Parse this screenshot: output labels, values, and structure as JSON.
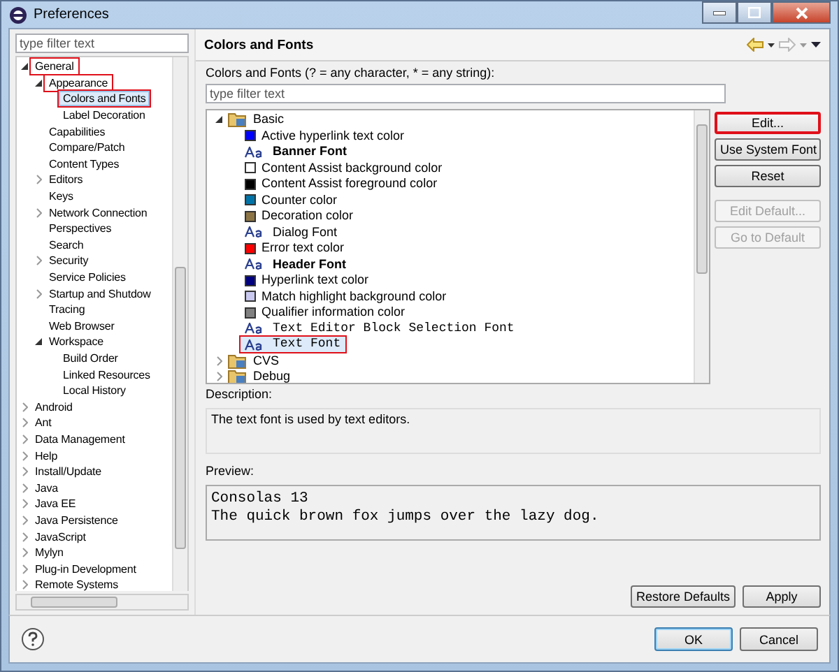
{
  "window": {
    "title": "Preferences"
  },
  "sidebar": {
    "filter": {
      "placeholder": "type filter text"
    },
    "tree": [
      {
        "label": "General",
        "expanded": true,
        "selected": false,
        "highlighted": true,
        "children": [
          {
            "label": "Appearance",
            "expanded": true,
            "selected": false,
            "highlighted": true,
            "children": [
              {
                "label": "Colors and Fonts",
                "selected": true,
                "highlighted": true
              },
              {
                "label": "Label Decoration",
                "selected": false,
                "highlighted": false
              }
            ]
          },
          {
            "label": "Capabilities",
            "selected": false,
            "highlighted": false
          },
          {
            "label": "Compare/Patch",
            "selected": false,
            "highlighted": false
          },
          {
            "label": "Content Types",
            "selected": false,
            "highlighted": false
          },
          {
            "label": "Editors",
            "expanded": false,
            "selected": false,
            "highlighted": false
          },
          {
            "label": "Keys",
            "selected": false,
            "highlighted": false
          },
          {
            "label": "Network Connection",
            "expanded": false,
            "selected": false,
            "highlighted": false
          },
          {
            "label": "Perspectives",
            "selected": false,
            "highlighted": false
          },
          {
            "label": "Search",
            "selected": false,
            "highlighted": false
          },
          {
            "label": "Security",
            "expanded": false,
            "selected": false,
            "highlighted": false
          },
          {
            "label": "Service Policies",
            "selected": false,
            "highlighted": false
          },
          {
            "label": "Startup and Shutdow",
            "expanded": false,
            "selected": false,
            "highlighted": false
          },
          {
            "label": "Tracing",
            "selected": false,
            "highlighted": false
          },
          {
            "label": "Web Browser",
            "selected": false,
            "highlighted": false
          },
          {
            "label": "Workspace",
            "expanded": true,
            "selected": false,
            "highlighted": false,
            "children": [
              {
                "label": "Build Order",
                "selected": false,
                "highlighted": false
              },
              {
                "label": "Linked Resources",
                "selected": false,
                "highlighted": false
              },
              {
                "label": "Local History",
                "selected": false,
                "highlighted": false
              }
            ]
          }
        ]
      },
      {
        "label": "Android",
        "expanded": false,
        "selected": false,
        "highlighted": false
      },
      {
        "label": "Ant",
        "expanded": false,
        "selected": false,
        "highlighted": false
      },
      {
        "label": "Data Management",
        "expanded": false,
        "selected": false,
        "highlighted": false
      },
      {
        "label": "Help",
        "expanded": false,
        "selected": false,
        "highlighted": false
      },
      {
        "label": "Install/Update",
        "expanded": false,
        "selected": false,
        "highlighted": false
      },
      {
        "label": "Java",
        "expanded": false,
        "selected": false,
        "highlighted": false
      },
      {
        "label": "Java EE",
        "expanded": false,
        "selected": false,
        "highlighted": false
      },
      {
        "label": "Java Persistence",
        "expanded": false,
        "selected": false,
        "highlighted": false
      },
      {
        "label": "JavaScript",
        "expanded": false,
        "selected": false,
        "highlighted": false
      },
      {
        "label": "Mylyn",
        "expanded": false,
        "selected": false,
        "highlighted": false
      },
      {
        "label": "Plug-in Development",
        "expanded": false,
        "selected": false,
        "highlighted": false
      },
      {
        "label": "Remote Systems",
        "expanded": false,
        "selected": false,
        "highlighted": false
      }
    ]
  },
  "page": {
    "title": "Colors and Fonts",
    "filter_label": "Colors and Fonts (? = any character, * = any string):",
    "filter": {
      "placeholder": "type filter text"
    },
    "tree": [
      {
        "label": "Basic",
        "expanded": true,
        "children": [
          {
            "kind": "color",
            "label": "Active hyperlink text color",
            "color": "#0000ff",
            "selected": false,
            "highlighted": false
          },
          {
            "kind": "boldfont",
            "label": "Banner Font",
            "selected": false,
            "highlighted": false
          },
          {
            "kind": "color",
            "label": "Content Assist background color",
            "color": "#ffffff",
            "selected": false,
            "highlighted": false
          },
          {
            "kind": "color",
            "label": "Content Assist foreground color",
            "color": "#000000",
            "selected": false,
            "highlighted": false
          },
          {
            "kind": "color",
            "label": "Counter color",
            "color": "#0074a8",
            "selected": false,
            "highlighted": false
          },
          {
            "kind": "color",
            "label": "Decoration color",
            "color": "#8c7444",
            "selected": false,
            "highlighted": false
          },
          {
            "kind": "font",
            "label": "Dialog Font",
            "selected": false,
            "highlighted": false
          },
          {
            "kind": "color",
            "label": "Error text color",
            "color": "#ff0000",
            "selected": false,
            "highlighted": false
          },
          {
            "kind": "boldfont",
            "label": "Header Font",
            "selected": false,
            "highlighted": false
          },
          {
            "kind": "color",
            "label": "Hyperlink text color",
            "color": "#000080",
            "selected": false,
            "highlighted": false
          },
          {
            "kind": "color",
            "label": "Match highlight background color",
            "color": "#c8c8f0",
            "selected": false,
            "highlighted": false
          },
          {
            "kind": "color",
            "label": "Qualifier information color",
            "color": "#808080",
            "selected": false,
            "highlighted": false
          },
          {
            "kind": "monofont",
            "label": "Text Editor Block Selection Font",
            "selected": false,
            "highlighted": false
          },
          {
            "kind": "monofont",
            "label": "Text Font",
            "selected": true,
            "highlighted": true
          }
        ]
      },
      {
        "label": "CVS",
        "expanded": false
      },
      {
        "label": "Debug",
        "expanded": false
      }
    ],
    "buttons": [
      {
        "label": "Edit...",
        "disabled": false,
        "highlighted": true
      },
      {
        "label": "Use System Font",
        "disabled": false,
        "highlighted": false
      },
      {
        "label": "Reset",
        "disabled": false,
        "highlighted": false
      },
      {
        "label": "Edit Default...",
        "disabled": true,
        "highlighted": false
      },
      {
        "label": "Go to Default",
        "disabled": true,
        "highlighted": false
      }
    ],
    "description_label": "Description:",
    "description": "The text font is used by text editors.",
    "preview_label": "Preview:",
    "preview": [
      "Consolas 13",
      "The quick brown fox jumps over the lazy dog."
    ],
    "actions": [
      "Restore Defaults",
      "Apply"
    ]
  },
  "footer": {
    "buttons": [
      {
        "label": "OK",
        "default": true
      },
      {
        "label": "Cancel",
        "default": false
      }
    ]
  }
}
